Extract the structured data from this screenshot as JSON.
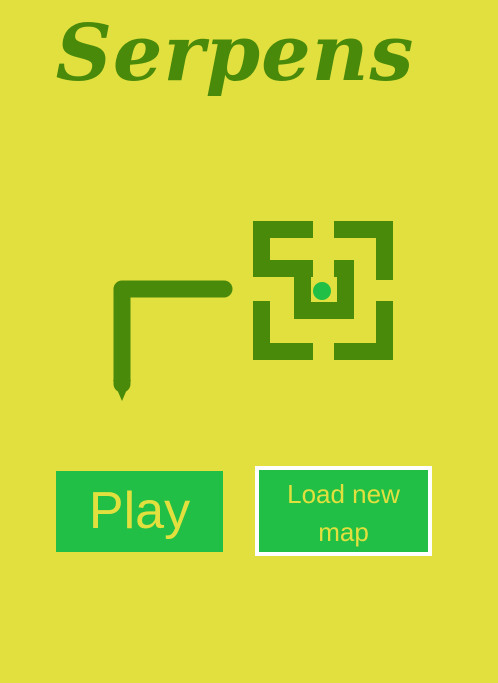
{
  "title": "Serpens",
  "menu": {
    "play_label": "Play",
    "load_map_label": "Load new map"
  },
  "colors": {
    "background": "#e1e03e",
    "snake": "#4a8a0b",
    "maze": "#4a8a0b",
    "food": "#22bf46",
    "button": "#22bf46",
    "button_text": "#e1e03e",
    "button_border": "#ffffff"
  },
  "decoration": {
    "snake": "snake-graphic",
    "maze": "maze-graphic",
    "food": "food-dot"
  }
}
